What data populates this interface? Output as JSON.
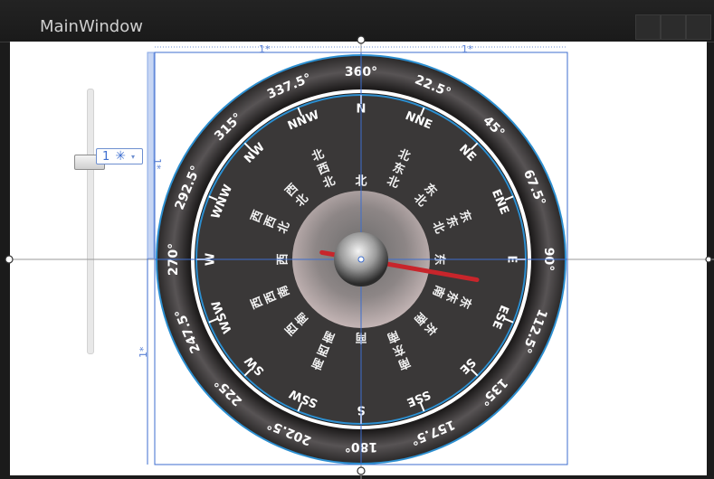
{
  "window": {
    "title": "MainWindow"
  },
  "grid": {
    "star_top": "1*",
    "star_top_right": "1*",
    "star_left": "1*",
    "star_left_bottom": "1*"
  },
  "row_chip": {
    "value": "1",
    "star": "✳",
    "caret": "▾"
  },
  "compass": {
    "outer_labels": [
      "360°",
      "22.5°",
      "45°",
      "67.5°",
      "90°",
      "112.5°",
      "135°",
      "157.5°",
      "180°",
      "202.5°",
      "225°",
      "247.5°",
      "270°",
      "292.5°",
      "315°",
      "337.5°"
    ],
    "inner_labels": [
      "N",
      "NNE",
      "NE",
      "ENE",
      "E",
      "ESE",
      "SE",
      "SSE",
      "S",
      "SSW",
      "SW",
      "WSW",
      "W",
      "WNW",
      "NW",
      "NNW"
    ],
    "cn_labels": [
      "北",
      "北东北",
      "东北",
      "东东北",
      "东",
      "东东南",
      "东南",
      "南东南",
      "南",
      "南西南",
      "西南",
      "西西南",
      "西",
      "西西北",
      "西北",
      "北西北"
    ],
    "needle_heading_deg": 100,
    "colors": {
      "north": "#e0102a",
      "needle": "#c8252b",
      "guides": "#3d6ecf"
    }
  }
}
